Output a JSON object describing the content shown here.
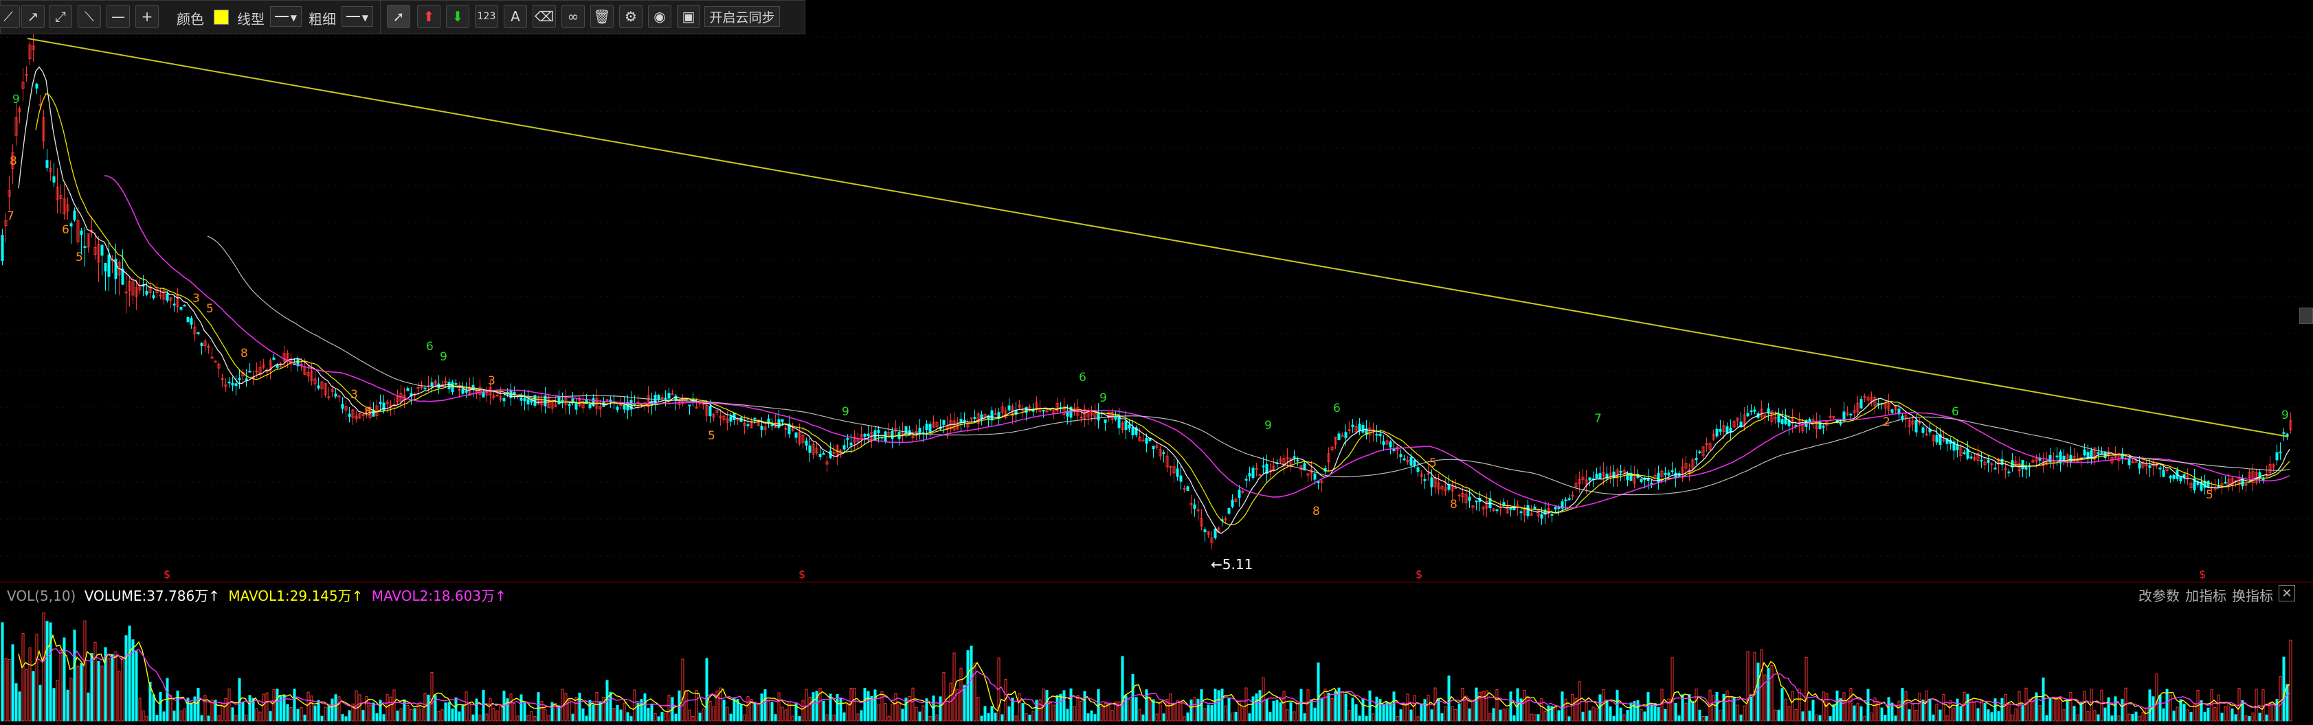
{
  "toolbar": {
    "color_label": "颜色",
    "color_value": "#ffff00",
    "linetype_label": "线型",
    "thickness_label": "粗细",
    "num_button_label": "123",
    "text_button_label": "A",
    "sync_button_label": "开启云同步",
    "icons": [
      "line-segment-icon",
      "ray-icon",
      "arrow-line-icon",
      "diagonal-line-icon",
      "horizontal-line-icon",
      "crosshair-icon",
      "pointer-icon",
      "up-arrow-icon",
      "down-arrow-icon",
      "number-icon",
      "text-icon",
      "eraser-icon",
      "link-icon",
      "delete-icon",
      "settings-icon",
      "eye-icon",
      "save-picture-icon"
    ]
  },
  "price_chart": {
    "type": "candlestick",
    "low_label": "←5.11",
    "up_color": "#ff3232",
    "down_color": "#00ffff",
    "trendline_color": "#c8c81e",
    "ma_colors": [
      "#ffffff",
      "#ffff00",
      "#ff33ff",
      "#d0d0d0"
    ],
    "signal_up_color": "#ff8c1a",
    "signal_down_color": "#28dc28",
    "bottom_markers": [
      "$",
      "$",
      "$",
      "$"
    ]
  },
  "volume_panel": {
    "title": "VOL(5,10)",
    "volume": "VOLUME:37.786万↑",
    "mavol1": "MAVOL1:29.145万↑",
    "mavol2": "MAVOL2:18.603万↑",
    "links": [
      "改参数",
      "加指标",
      "换指标"
    ],
    "close": "✕"
  }
}
